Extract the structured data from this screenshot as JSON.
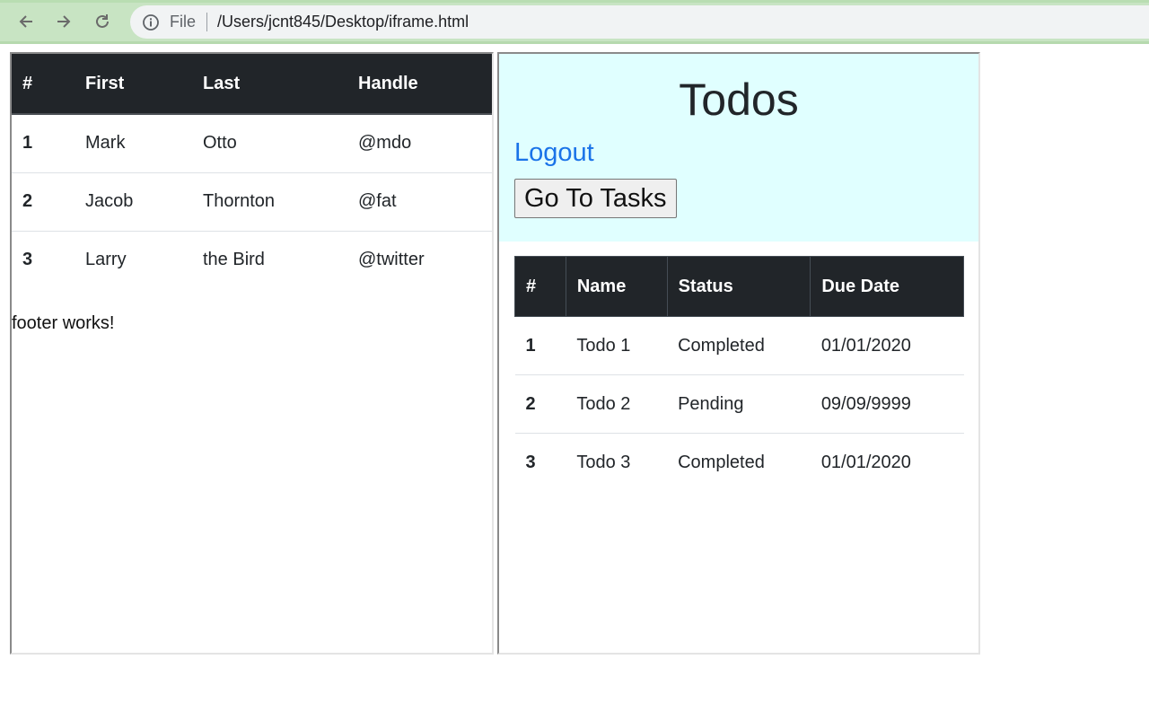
{
  "browser": {
    "file_label": "File",
    "url": "/Users/jcnt845/Desktop/iframe.html"
  },
  "users_table": {
    "headers": [
      "#",
      "First",
      "Last",
      "Handle"
    ],
    "rows": [
      [
        "1",
        "Mark",
        "Otto",
        "@mdo"
      ],
      [
        "2",
        "Jacob",
        "Thornton",
        "@fat"
      ],
      [
        "3",
        "Larry",
        "the Bird",
        "@twitter"
      ]
    ],
    "footer": "footer works!"
  },
  "todos": {
    "title": "Todos",
    "logout_label": "Logout",
    "tasks_button_label": "Go To Tasks",
    "headers": [
      "#",
      "Name",
      "Status",
      "Due Date"
    ],
    "rows": [
      [
        "1",
        "Todo 1",
        "Completed",
        "01/01/2020"
      ],
      [
        "2",
        "Todo 2",
        "Pending",
        "09/09/9999"
      ],
      [
        "3",
        "Todo 3",
        "Completed",
        "01/01/2020"
      ]
    ]
  },
  "colors": {
    "toolbar": "#c8e4c3",
    "table_header": "#212529",
    "todo_header_bg": "#e0ffff",
    "link": "#1a73e8"
  }
}
